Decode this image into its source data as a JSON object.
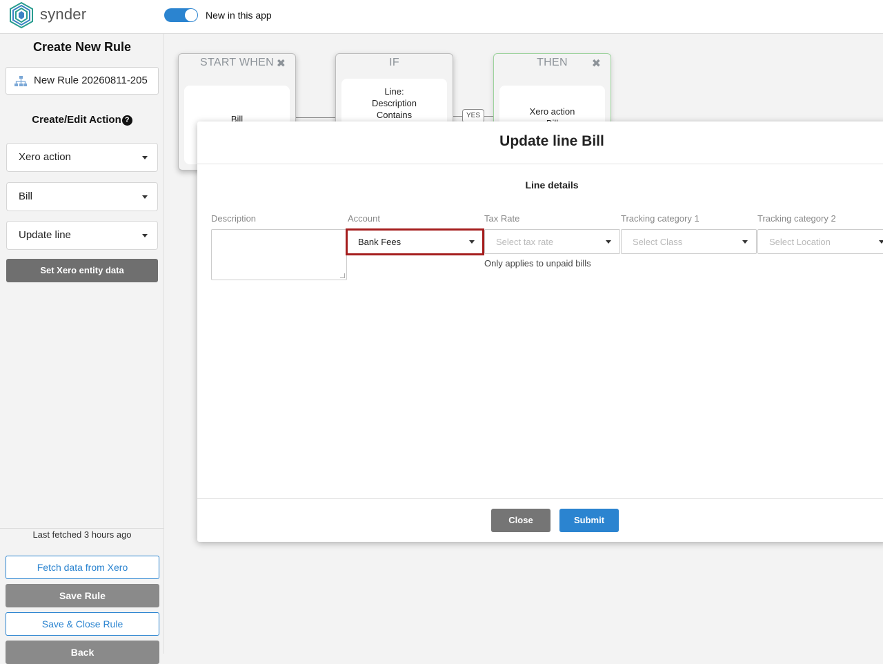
{
  "topbar": {
    "brand": "synder",
    "toggle_label": "New in this app",
    "toggle_on": true,
    "accent_color": "#2b84d0"
  },
  "sidebar": {
    "title": "Create New Rule",
    "rule_name": "New Rule 20260811-205",
    "rule_icon": "sitemap-icon",
    "section_title": "Create/Edit Action",
    "help_icon": "question-circle-icon",
    "selects": [
      "Xero action",
      "Bill",
      "Update line"
    ],
    "set_entity_button": "Set Xero entity data",
    "last_fetched": "Last fetched 3 hours ago",
    "fetch_button": "Fetch data from Xero",
    "save_button": "Save Rule",
    "save_close_button": "Save & Close Rule",
    "back_button": "Back"
  },
  "canvas": {
    "start_card": {
      "header": "START WHEN",
      "body": "Bill"
    },
    "if_card": {
      "header": "IF",
      "body_lines": [
        "Line:",
        "Description",
        "Contains"
      ]
    },
    "yes_label": "YES",
    "then_card": {
      "header": "THEN",
      "body_lines": [
        "Xero action",
        "Bill"
      ]
    },
    "close_icon": "x-icon",
    "then_border_color": "#9ed39e"
  },
  "modal": {
    "title": "Update line Bill",
    "section_title": "Line details",
    "fields": {
      "description": {
        "label": "Description",
        "value": ""
      },
      "account": {
        "label": "Account",
        "value": "Bank Fees"
      },
      "tax_rate": {
        "label": "Tax Rate",
        "placeholder": "Select tax rate",
        "hint": "Only applies to unpaid bills"
      },
      "tracking1": {
        "label": "Tracking category 1",
        "placeholder": "Select Class"
      },
      "tracking2": {
        "label": "Tracking category 2",
        "placeholder": "Select Location"
      }
    },
    "close_button": "Close",
    "submit_button": "Submit",
    "highlight_color": "#a51d1d"
  }
}
